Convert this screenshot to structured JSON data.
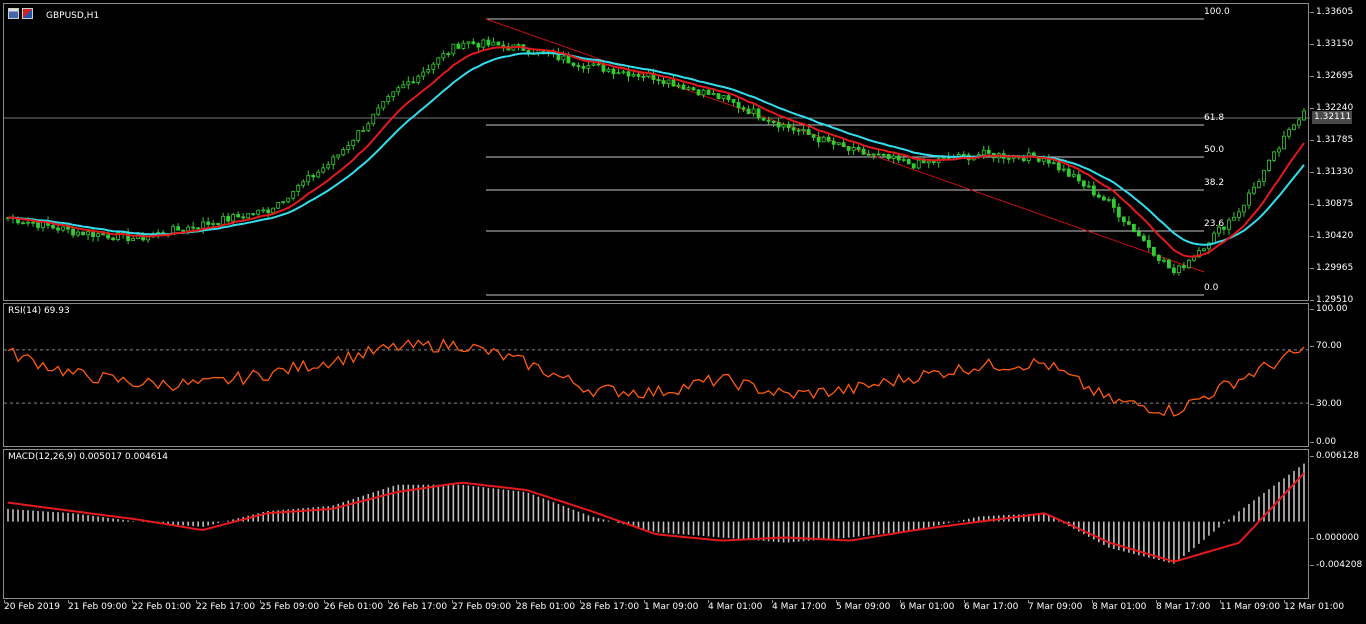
{
  "symbol": "GBPUSD,H1",
  "colors": {
    "background": "#000000",
    "candle": "#33cc33",
    "ma_fast": "#e31a1c",
    "ma_slow": "#33ddee",
    "fibo": "#c8c8c8",
    "trendline": "#cc1111",
    "rsi": "#ff5a10",
    "macd_hist": "#c0c0c0",
    "macd_signal": "#e31a1c"
  },
  "main_axis": {
    "labels": [
      "1.33605",
      "1.33150",
      "1.32695",
      "1.32240",
      "1.31785",
      "1.31330",
      "1.30875",
      "1.30420",
      "1.29965",
      "1.29510"
    ],
    "current_price": "1.32111"
  },
  "fibo_levels": [
    "100.0",
    "61.8",
    "50.0",
    "38.2",
    "23.6",
    "0.0"
  ],
  "rsi": {
    "title": "RSI(14) 69.93",
    "axis_labels": [
      "100.00",
      "70.00",
      "30.00",
      "0.00"
    ]
  },
  "macd": {
    "title": "MACD(12,26,9) 0.005017 0.004614",
    "axis_labels": [
      "0.006128",
      "0.000000",
      "-0.004208"
    ]
  },
  "time_axis": [
    "20 Feb 2019",
    "21 Feb 09:00",
    "22 Feb 01:00",
    "22 Feb 17:00",
    "25 Feb 09:00",
    "26 Feb 01:00",
    "26 Feb 17:00",
    "27 Feb 09:00",
    "28 Feb 01:00",
    "28 Feb 17:00",
    "1 Mar 09:00",
    "4 Mar 01:00",
    "4 Mar 17:00",
    "5 Mar 09:00",
    "6 Mar 01:00",
    "6 Mar 17:00",
    "7 Mar 09:00",
    "8 Mar 01:00",
    "8 Mar 17:00",
    "11 Mar 09:00",
    "12 Mar 01:00"
  ],
  "chart_data": {
    "type": "line",
    "title": "GBPUSD,H1",
    "x": [
      "20 Feb 2019",
      "21 Feb 09:00",
      "22 Feb 01:00",
      "22 Feb 17:00",
      "25 Feb 09:00",
      "26 Feb 01:00",
      "26 Feb 17:00",
      "27 Feb 09:00",
      "28 Feb 01:00",
      "28 Feb 17:00",
      "1 Mar 09:00",
      "4 Mar 01:00",
      "4 Mar 17:00",
      "5 Mar 09:00",
      "6 Mar 01:00",
      "6 Mar 17:00",
      "7 Mar 09:00",
      "8 Mar 01:00",
      "8 Mar 17:00",
      "11 Mar 09:00",
      "12 Mar 01:00"
    ],
    "series": [
      {
        "name": "",
        "values": [
          1.307,
          1.305,
          1.304,
          1.306,
          1.308,
          1.315,
          1.325,
          1.332,
          1.331,
          1.3285,
          1.327,
          1.324,
          1.32,
          1.3165,
          1.3145,
          1.316,
          1.3155,
          1.309,
          1.299,
          1.308,
          1.3225
        ]
      }
    ],
    "ylim": [
      1.2951,
      1.3361
    ],
    "rsi_values": [
      68,
      52,
      45,
      44,
      52,
      62,
      72,
      74,
      60,
      40,
      38,
      48,
      36,
      40,
      50,
      58,
      60,
      32,
      24,
      48,
      70
    ],
    "macd_values": [
      0.0012,
      0.0008,
      0.0,
      -0.0005,
      0.001,
      0.0015,
      0.0035,
      0.0035,
      0.0028,
      0.0005,
      -0.001,
      -0.0015,
      -0.002,
      -0.0015,
      -0.0008,
      0.0005,
      0.0008,
      -0.0025,
      -0.004,
      0.001,
      0.0055
    ],
    "macd_signal_values": [
      0.0018,
      0.001,
      0.0002,
      -0.0008,
      0.0008,
      0.0012,
      0.0028,
      0.0037,
      0.003,
      0.001,
      -0.0012,
      -0.0018,
      -0.0015,
      -0.0018,
      -0.0008,
      0.0,
      0.0008,
      -0.002,
      -0.0038,
      -0.002,
      0.0046
    ],
    "grid": false,
    "legend": "none"
  }
}
